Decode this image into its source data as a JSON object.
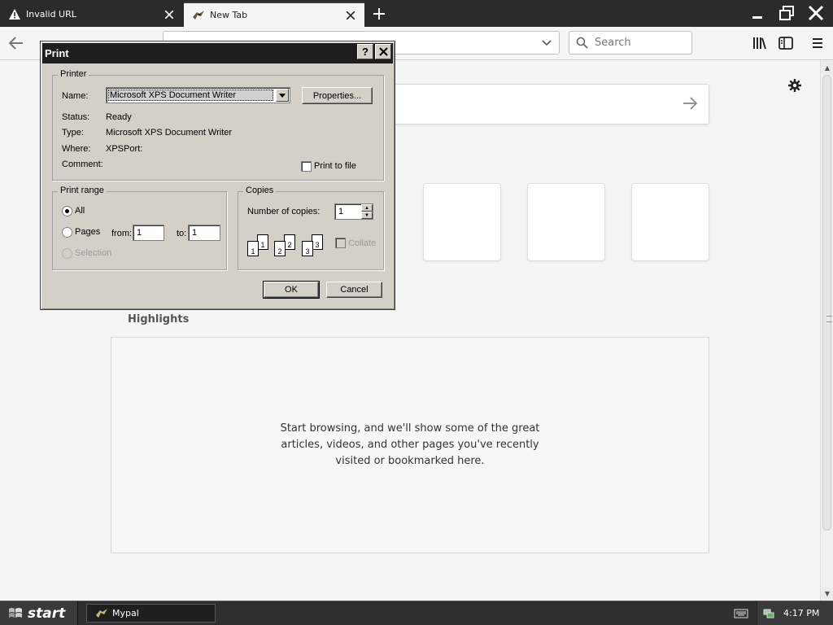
{
  "browser": {
    "tabs": [
      {
        "label": "Invalid URL",
        "icon": "warning-icon",
        "active": false
      },
      {
        "label": "New Tab",
        "icon": "mypal-icon",
        "active": true
      }
    ],
    "search_placeholder": "Search"
  },
  "newtab": {
    "highlights_title": "Highlights",
    "highlights_empty": "Start browsing, and we'll show some of the great articles, videos, and other pages you've recently visited or bookmarked here."
  },
  "print_dialog": {
    "title": "Print",
    "help_button": "?",
    "printer_group": "Printer",
    "name_label": "Name:",
    "printer_name": "Microsoft XPS Document Writer",
    "properties_button": "Properties...",
    "status_label": "Status:",
    "status_value": "Ready",
    "type_label": "Type:",
    "type_value": "Microsoft XPS Document Writer",
    "where_label": "Where:",
    "where_value": "XPSPort:",
    "comment_label": "Comment:",
    "comment_value": "",
    "print_to_file": "Print to file",
    "print_range_group": "Print range",
    "range_all": "All",
    "range_pages": "Pages",
    "range_selection": "Selection",
    "from_label": "from:",
    "from_value": "1",
    "to_label": "to:",
    "to_value": "1",
    "copies_group": "Copies",
    "copies_label": "Number of copies:",
    "copies_value": "1",
    "collate_label": "Collate",
    "collate_pages": [
      "1",
      "1",
      "2",
      "2",
      "3",
      "3"
    ],
    "ok_button": "OK",
    "cancel_button": "Cancel"
  },
  "taskbar": {
    "start_label": "start",
    "task_label": "Mypal",
    "clock": "4:17 PM"
  },
  "colors": {
    "title_bar": "#1e1e1e",
    "dialog_face": "#d4d0c8",
    "tab_strip": "#2b2b2b",
    "page_bg": "#f5f5f6"
  }
}
